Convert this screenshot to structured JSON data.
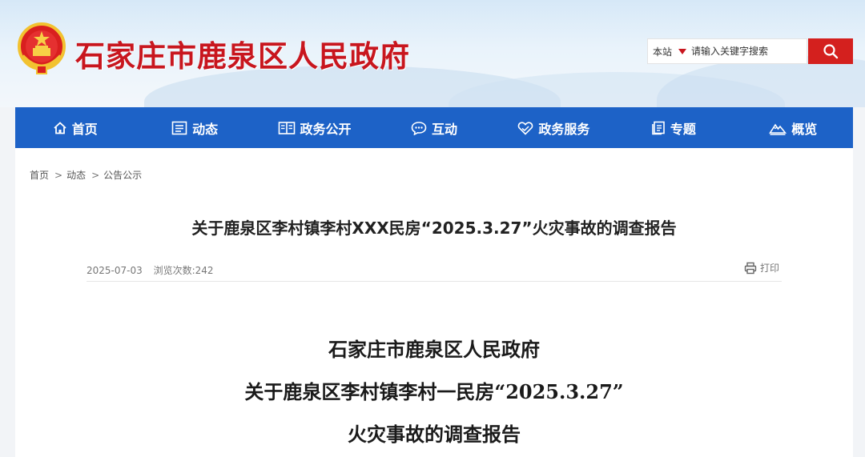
{
  "header": {
    "site_title": "石家庄市鹿泉区人民政府",
    "search": {
      "scope": "本站",
      "placeholder": "请输入关键字搜索"
    }
  },
  "nav": {
    "items": [
      {
        "label": "首页",
        "icon": "home-icon"
      },
      {
        "label": "动态",
        "icon": "news-icon"
      },
      {
        "label": "政务公开",
        "icon": "book-icon"
      },
      {
        "label": "互动",
        "icon": "chat-icon"
      },
      {
        "label": "政务服务",
        "icon": "heart-hand-icon"
      },
      {
        "label": "专题",
        "icon": "document-icon"
      },
      {
        "label": "概览",
        "icon": "mountain-icon"
      }
    ]
  },
  "breadcrumb": {
    "items": [
      "首页",
      "动态",
      "公告公示"
    ],
    "separator": ">"
  },
  "article": {
    "title": "关于鹿泉区李村镇李村XXX民房“2025.3.27”火灾事故的调查报告",
    "date": "2025-07-03",
    "views": "浏览次数:242",
    "print_label": "打印",
    "body_heading": [
      "石家庄市鹿泉区人民政府",
      "关于鹿泉区李村镇李村一民房“2025.3.27”",
      "火灾事故的调查报告"
    ]
  },
  "colors": {
    "nav_bg": "#1d62c7",
    "brand_red": "#c8161e",
    "search_btn": "#d4201e"
  }
}
